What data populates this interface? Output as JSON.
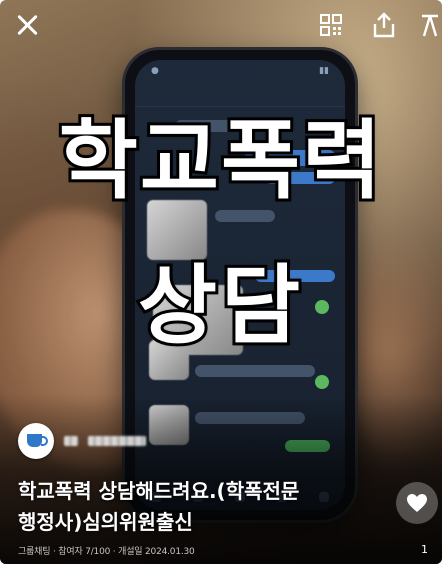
{
  "post": {
    "overlay_title_line1": "학교폭력",
    "overlay_title_line2": "상담",
    "caption": "학교폭력 상담해드려요.(학폭전문\n행정사)심의위원출신",
    "meta": "그룹채팅 · 참여자 7/100 · 개설일 2024.01.30",
    "page_number": "1"
  },
  "icons": {
    "close": "close-icon",
    "qr": "qr-code-icon",
    "share": "share-icon",
    "more": "more-icon",
    "avatar": "coffee-cup-icon",
    "heart": "heart-icon"
  },
  "colors": {
    "caption_text": "#ffffff",
    "overlay_stroke": "#000000",
    "avatar_accent": "#2f78c8"
  }
}
